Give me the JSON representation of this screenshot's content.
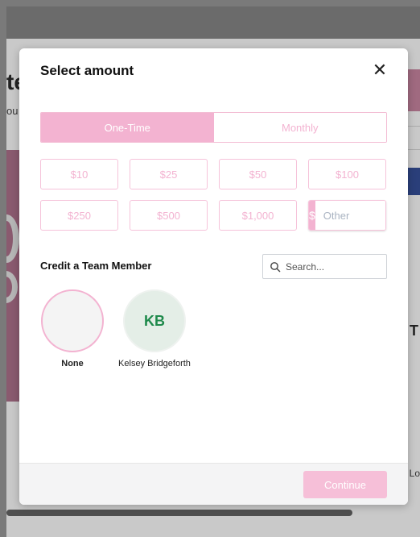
{
  "background": {
    "heading_fragment": "te",
    "subtext_fragment": "ou",
    "right_fragment_t": "T",
    "right_fragment_lo": "Lo"
  },
  "modal": {
    "title": "Select amount",
    "close_glyph": "✕",
    "frequency": {
      "options": [
        "One-Time",
        "Monthly"
      ],
      "selected": "One-Time"
    },
    "amounts": [
      "$10",
      "$25",
      "$50",
      "$100",
      "$250",
      "$500",
      "$1,000"
    ],
    "other": {
      "prefix": "$",
      "placeholder": "Other"
    },
    "credit": {
      "label": "Credit a Team Member",
      "search_placeholder": "Search...",
      "members": [
        {
          "initials": "",
          "name": "None"
        },
        {
          "initials": "KB",
          "name": "Kelsey Bridgeforth"
        }
      ]
    },
    "footer": {
      "continue_label": "Continue"
    }
  },
  "colors": {
    "accent_pink": "#f3b3d1",
    "avatar_green": "#1f8a4c"
  }
}
